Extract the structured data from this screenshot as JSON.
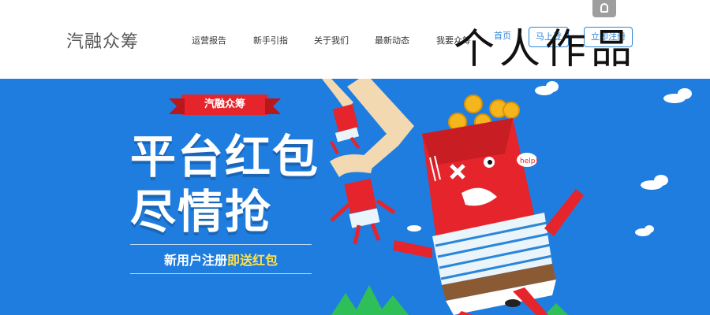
{
  "header": {
    "brand": "汽融众筹",
    "nav": [
      "运营报告",
      "新手引指",
      "关于我们",
      "最新动态",
      "我要众筹"
    ],
    "home_label": "首页",
    "login_label": "马上登",
    "register_label": "立即注册",
    "watermark": "个人作品"
  },
  "banner": {
    "ribbon": "汽融众筹",
    "line1": "平台红包",
    "line2": "尽情抢",
    "sub_white": "新用户注册",
    "sub_yellow": "即送红包",
    "help": "help!",
    "colors": {
      "bg": "#1f7de0",
      "red": "#e5242b",
      "yellow": "#ffe14a"
    }
  }
}
